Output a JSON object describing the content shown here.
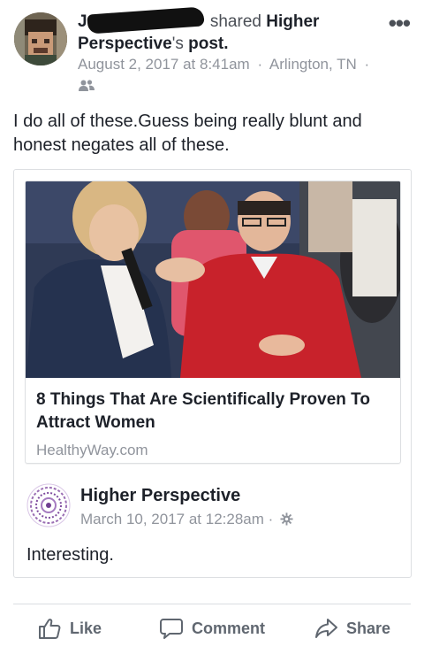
{
  "post": {
    "author_initial": "J",
    "shared_verb": "shared",
    "shared_page": "Higher Perspective",
    "shared_suffix": "'s",
    "post_word": "post.",
    "date": "August 2, 2017 at 8:41am",
    "location": "Arlington, TN",
    "meta_sep": "·",
    "audience_icon": "friends-icon",
    "more_label": "•••",
    "status_text": "I do all of these.Guess being really blunt and honest negates all of these."
  },
  "link": {
    "title": "8 Things That Are Scientifically Proven To Attract Women",
    "domain": "HealthyWay.com"
  },
  "original": {
    "page_name": "Higher Perspective",
    "date": "March 10, 2017 at 12:28am",
    "meta_sep": "·",
    "privacy_icon": "public-gear-icon",
    "text": "Interesting."
  },
  "actions": {
    "like_label": "Like",
    "comment_label": "Comment",
    "share_label": "Share"
  },
  "colors": {
    "text_primary": "#1d2129",
    "text_secondary": "#90949c",
    "action_gray": "#606770",
    "border": "#dddfe2"
  }
}
